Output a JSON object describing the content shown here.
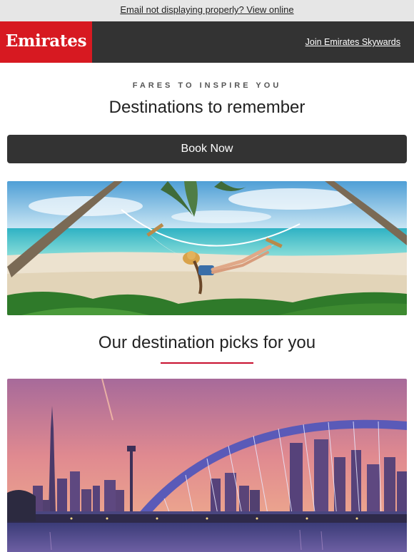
{
  "preheader": {
    "view_online_label": "Email not displaying properly? View online"
  },
  "header": {
    "brand": "Emirates",
    "skywards_link": "Join Emirates Skywards",
    "brand_color": "#d71921",
    "bar_color": "#333333"
  },
  "intro": {
    "kicker": "FARES TO INSPIRE YOU",
    "headline": "Destinations to remember",
    "cta_label": "Book Now"
  },
  "hero_image": {
    "icon": "beach-hammock-image"
  },
  "picks": {
    "title": "Our destination picks for you",
    "accent_color": "#c8102e"
  },
  "city_image": {
    "icon": "dubai-skyline-image"
  }
}
